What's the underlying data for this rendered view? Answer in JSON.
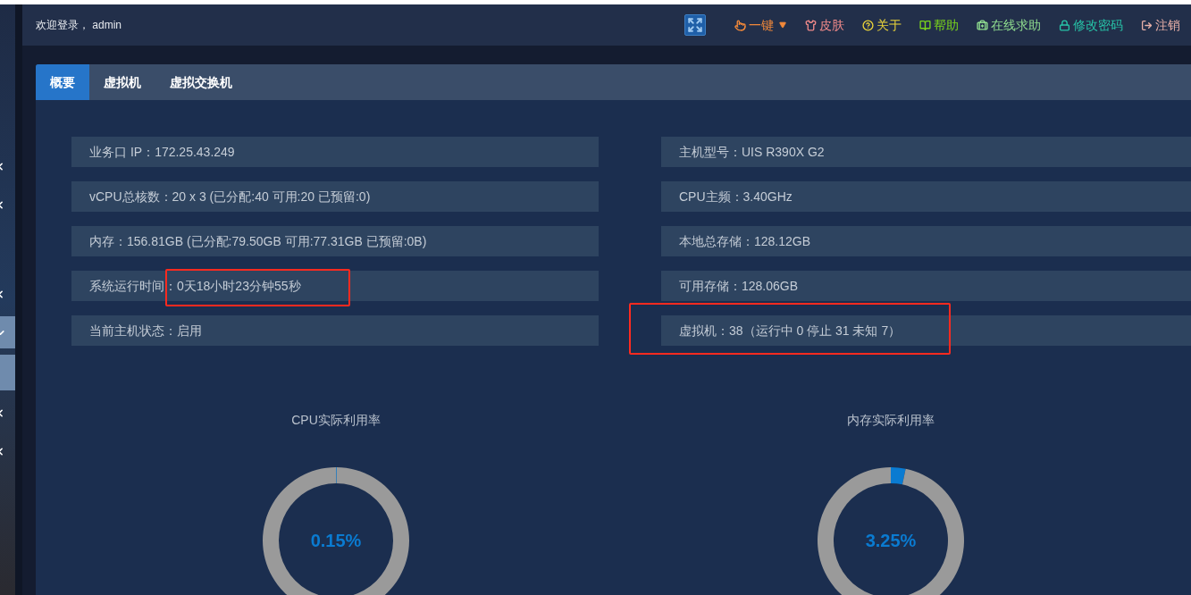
{
  "sidebar": {
    "items": [
      {
        "expanded": false,
        "selected": false
      },
      {
        "expanded": false,
        "selected": false
      },
      {
        "expanded": false,
        "selected": false
      },
      {
        "expanded": true,
        "selected": true,
        "children": [
          {
            "selected": true
          }
        ]
      },
      {
        "expanded": false,
        "selected": false
      },
      {
        "expanded": false,
        "selected": false
      }
    ]
  },
  "header": {
    "welcome": "欢迎登录， admin",
    "actions": [
      {
        "kind": "oneclick",
        "label": "一键",
        "color": "#f0883a"
      },
      {
        "kind": "skin",
        "label": "皮肤",
        "color": "#f08a8a"
      },
      {
        "kind": "about",
        "label": "关于",
        "color": "#e8d23a"
      },
      {
        "kind": "help",
        "label": "帮助",
        "color": "#7bd51c"
      },
      {
        "kind": "support",
        "label": "在线求助",
        "color": "#8fdc8f"
      },
      {
        "kind": "password",
        "label": "修改密码",
        "color": "#27c4a8"
      },
      {
        "kind": "logout",
        "label": "注销",
        "color": "#e8b0a8"
      }
    ]
  },
  "tabs": [
    {
      "label": "概要",
      "selected": true
    },
    {
      "label": "虚拟机",
      "selected": false
    },
    {
      "label": "虚拟交换机",
      "selected": false
    }
  ],
  "info_left": [
    {
      "label": "业务口 IP：",
      "value": "172.25.43.249",
      "highlighted": false
    },
    {
      "label": "vCPU总核数：",
      "value": "20 x 3 (已分配:40 可用:20 已预留:0)",
      "highlighted": false
    },
    {
      "label": "内存：",
      "value": "156.81GB (已分配:79.50GB 可用:77.31GB 已预留:0B)",
      "highlighted": false
    },
    {
      "label": "系统运行时间：",
      "value": "0天18小时23分钟55秒",
      "highlighted": true
    },
    {
      "label": "当前主机状态：",
      "value": "启用",
      "highlighted": false
    }
  ],
  "info_right": [
    {
      "label": "主机型号：",
      "value": "UIS R390X G2",
      "highlighted": false
    },
    {
      "label": "CPU主频：",
      "value": "3.40GHz",
      "highlighted": false
    },
    {
      "label": "本地总存储：",
      "value": "128.12GB",
      "highlighted": false
    },
    {
      "label": "可用存储：",
      "value": "128.06GB",
      "highlighted": false
    },
    {
      "label": "虚拟机：",
      "value": "38（运行中 0 停止 31 未知 7）",
      "highlighted": true
    }
  ],
  "gauges": [
    {
      "chart_data": {
        "type": "donut",
        "title": "CPU实际利用率",
        "values": [
          0.15,
          99.85
        ]
      },
      "reading": "0.15%"
    },
    {
      "chart_data": {
        "type": "donut",
        "title": "内存实际利用率",
        "values": [
          3.25,
          96.75
        ]
      },
      "reading": "3.25%"
    }
  ]
}
